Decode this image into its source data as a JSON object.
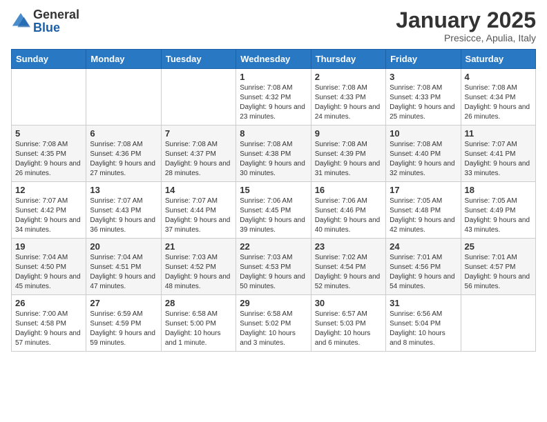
{
  "logo": {
    "general": "General",
    "blue": "Blue"
  },
  "header": {
    "month": "January 2025",
    "location": "Presicce, Apulia, Italy"
  },
  "weekdays": [
    "Sunday",
    "Monday",
    "Tuesday",
    "Wednesday",
    "Thursday",
    "Friday",
    "Saturday"
  ],
  "weeks": [
    [
      null,
      null,
      null,
      {
        "day": 1,
        "sunrise": "7:08 AM",
        "sunset": "4:32 PM",
        "daylight": "9 hours and 23 minutes."
      },
      {
        "day": 2,
        "sunrise": "7:08 AM",
        "sunset": "4:33 PM",
        "daylight": "9 hours and 24 minutes."
      },
      {
        "day": 3,
        "sunrise": "7:08 AM",
        "sunset": "4:33 PM",
        "daylight": "9 hours and 25 minutes."
      },
      {
        "day": 4,
        "sunrise": "7:08 AM",
        "sunset": "4:34 PM",
        "daylight": "9 hours and 26 minutes."
      }
    ],
    [
      {
        "day": 5,
        "sunrise": "7:08 AM",
        "sunset": "4:35 PM",
        "daylight": "9 hours and 26 minutes."
      },
      {
        "day": 6,
        "sunrise": "7:08 AM",
        "sunset": "4:36 PM",
        "daylight": "9 hours and 27 minutes."
      },
      {
        "day": 7,
        "sunrise": "7:08 AM",
        "sunset": "4:37 PM",
        "daylight": "9 hours and 28 minutes."
      },
      {
        "day": 8,
        "sunrise": "7:08 AM",
        "sunset": "4:38 PM",
        "daylight": "9 hours and 30 minutes."
      },
      {
        "day": 9,
        "sunrise": "7:08 AM",
        "sunset": "4:39 PM",
        "daylight": "9 hours and 31 minutes."
      },
      {
        "day": 10,
        "sunrise": "7:08 AM",
        "sunset": "4:40 PM",
        "daylight": "9 hours and 32 minutes."
      },
      {
        "day": 11,
        "sunrise": "7:07 AM",
        "sunset": "4:41 PM",
        "daylight": "9 hours and 33 minutes."
      }
    ],
    [
      {
        "day": 12,
        "sunrise": "7:07 AM",
        "sunset": "4:42 PM",
        "daylight": "9 hours and 34 minutes."
      },
      {
        "day": 13,
        "sunrise": "7:07 AM",
        "sunset": "4:43 PM",
        "daylight": "9 hours and 36 minutes."
      },
      {
        "day": 14,
        "sunrise": "7:07 AM",
        "sunset": "4:44 PM",
        "daylight": "9 hours and 37 minutes."
      },
      {
        "day": 15,
        "sunrise": "7:06 AM",
        "sunset": "4:45 PM",
        "daylight": "9 hours and 39 minutes."
      },
      {
        "day": 16,
        "sunrise": "7:06 AM",
        "sunset": "4:46 PM",
        "daylight": "9 hours and 40 minutes."
      },
      {
        "day": 17,
        "sunrise": "7:05 AM",
        "sunset": "4:48 PM",
        "daylight": "9 hours and 42 minutes."
      },
      {
        "day": 18,
        "sunrise": "7:05 AM",
        "sunset": "4:49 PM",
        "daylight": "9 hours and 43 minutes."
      }
    ],
    [
      {
        "day": 19,
        "sunrise": "7:04 AM",
        "sunset": "4:50 PM",
        "daylight": "9 hours and 45 minutes."
      },
      {
        "day": 20,
        "sunrise": "7:04 AM",
        "sunset": "4:51 PM",
        "daylight": "9 hours and 47 minutes."
      },
      {
        "day": 21,
        "sunrise": "7:03 AM",
        "sunset": "4:52 PM",
        "daylight": "9 hours and 48 minutes."
      },
      {
        "day": 22,
        "sunrise": "7:03 AM",
        "sunset": "4:53 PM",
        "daylight": "9 hours and 50 minutes."
      },
      {
        "day": 23,
        "sunrise": "7:02 AM",
        "sunset": "4:54 PM",
        "daylight": "9 hours and 52 minutes."
      },
      {
        "day": 24,
        "sunrise": "7:01 AM",
        "sunset": "4:56 PM",
        "daylight": "9 hours and 54 minutes."
      },
      {
        "day": 25,
        "sunrise": "7:01 AM",
        "sunset": "4:57 PM",
        "daylight": "9 hours and 56 minutes."
      }
    ],
    [
      {
        "day": 26,
        "sunrise": "7:00 AM",
        "sunset": "4:58 PM",
        "daylight": "9 hours and 57 minutes."
      },
      {
        "day": 27,
        "sunrise": "6:59 AM",
        "sunset": "4:59 PM",
        "daylight": "9 hours and 59 minutes."
      },
      {
        "day": 28,
        "sunrise": "6:58 AM",
        "sunset": "5:00 PM",
        "daylight": "10 hours and 1 minute."
      },
      {
        "day": 29,
        "sunrise": "6:58 AM",
        "sunset": "5:02 PM",
        "daylight": "10 hours and 3 minutes."
      },
      {
        "day": 30,
        "sunrise": "6:57 AM",
        "sunset": "5:03 PM",
        "daylight": "10 hours and 6 minutes."
      },
      {
        "day": 31,
        "sunrise": "6:56 AM",
        "sunset": "5:04 PM",
        "daylight": "10 hours and 8 minutes."
      },
      null
    ]
  ],
  "labels": {
    "sunrise": "Sunrise:",
    "sunset": "Sunset:",
    "daylight": "Daylight:"
  }
}
